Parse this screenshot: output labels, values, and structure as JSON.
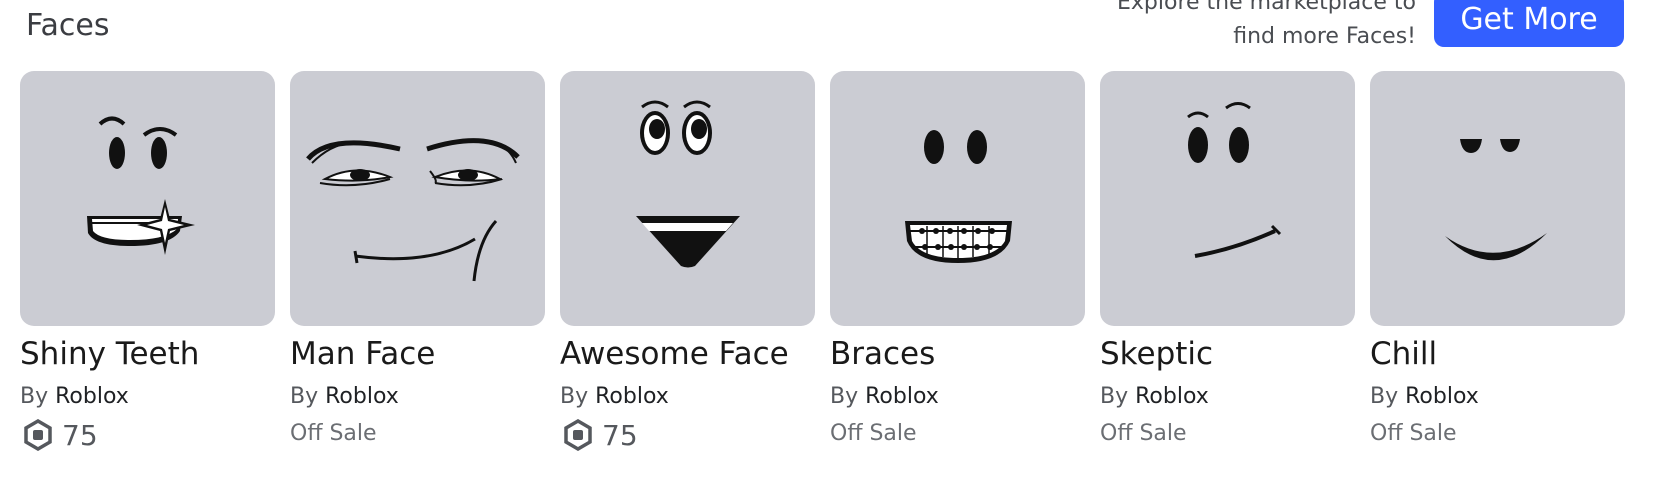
{
  "section": {
    "title": "Faces"
  },
  "promo": {
    "line1": "Explore the marketplace to",
    "line2": "find more Faces!",
    "button_label": "Get More",
    "button_color": "#335fff"
  },
  "items": [
    {
      "name": "Shiny Teeth",
      "by_label": "By",
      "creator": "Roblox",
      "price": "75",
      "off_sale": null,
      "icon": "shiny-teeth-face-thumbnail"
    },
    {
      "name": "Man Face",
      "by_label": "By",
      "creator": "Roblox",
      "price": null,
      "off_sale": "Off Sale",
      "icon": "man-face-thumbnail"
    },
    {
      "name": "Awesome Face",
      "by_label": "By",
      "creator": "Roblox",
      "price": "75",
      "off_sale": null,
      "icon": "awesome-face-thumbnail"
    },
    {
      "name": "Braces",
      "by_label": "By",
      "creator": "Roblox",
      "price": null,
      "off_sale": "Off Sale",
      "icon": "braces-face-thumbnail"
    },
    {
      "name": "Skeptic",
      "by_label": "By",
      "creator": "Roblox",
      "price": null,
      "off_sale": "Off Sale",
      "icon": "skeptic-face-thumbnail"
    },
    {
      "name": "Chill",
      "by_label": "By",
      "creator": "Roblox",
      "price": null,
      "off_sale": "Off Sale",
      "icon": "chill-face-thumbnail"
    }
  ],
  "colors": {
    "thumbnail_bg": "#cbccd3",
    "robux_icon": "#55585d"
  }
}
